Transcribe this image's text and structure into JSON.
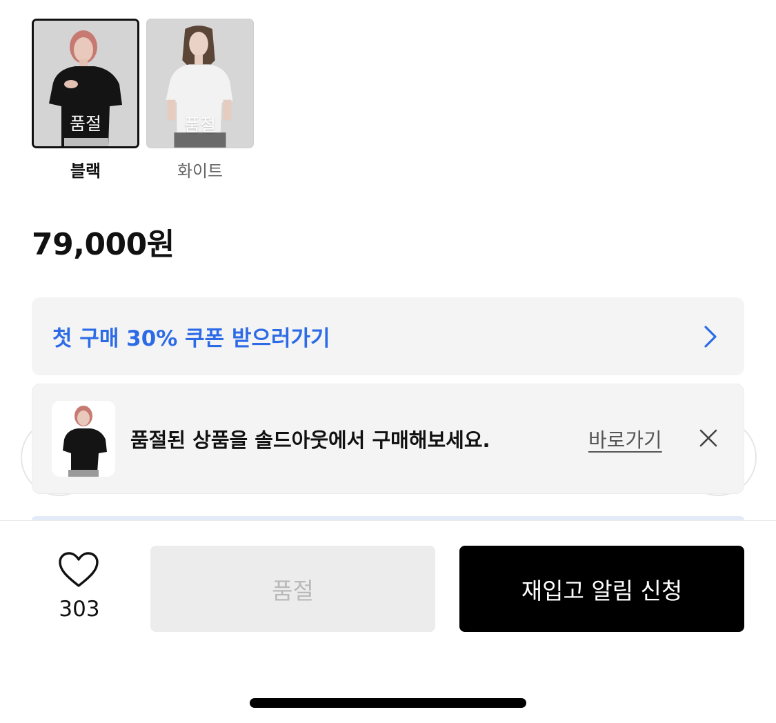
{
  "colors": {
    "accent": "#2d6be6",
    "primary_button": "#000000",
    "disabled_button": "#ececec",
    "banner_bg": "#f4f4f5"
  },
  "options": [
    {
      "label": "블랙",
      "tag": "품절",
      "selected": true
    },
    {
      "label": "화이트",
      "tag": "품절",
      "selected": false
    }
  ],
  "price": "79,000원",
  "coupon": {
    "text": "첫 구매 30% 쿠폰 받으러가기",
    "icon": "chevron-right-icon"
  },
  "soldout_banner": {
    "message": "품절된 상품을 솔드아웃에서 구매해보세요.",
    "link_label": "바로가기",
    "close_icon": "close-icon"
  },
  "bottom_bar": {
    "like_count": "303",
    "like_icon": "heart-icon",
    "soldout_label": "품절",
    "restock_label": "재입고 알림 신청"
  }
}
